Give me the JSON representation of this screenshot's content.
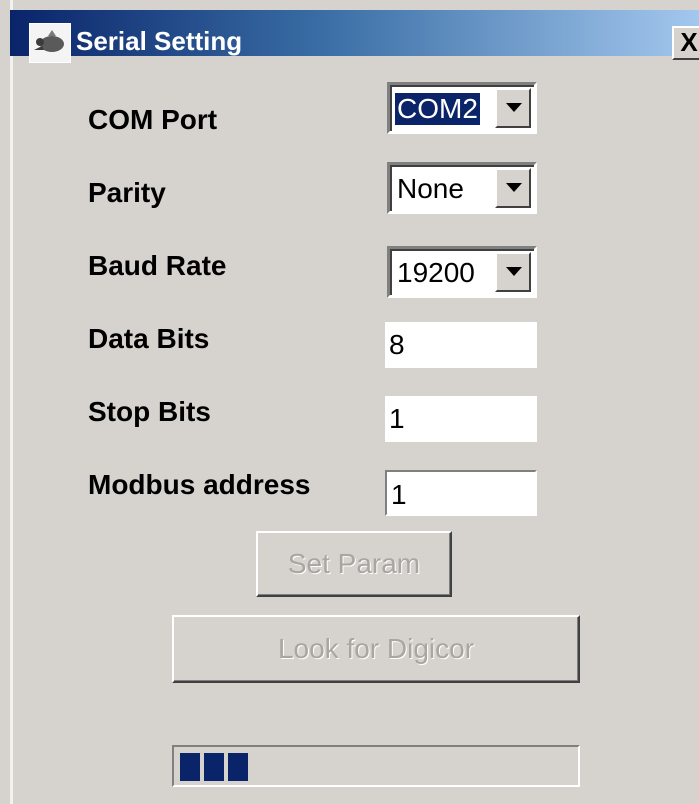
{
  "window": {
    "title": "Serial Setting",
    "close_glyph": "X",
    "icon": "app-icon"
  },
  "form": {
    "com_port": {
      "label": "COM Port",
      "value": "COM2"
    },
    "parity": {
      "label": "Parity",
      "value": "None"
    },
    "baud_rate": {
      "label": "Baud Rate",
      "value": "19200"
    },
    "data_bits": {
      "label": "Data Bits",
      "value": "8"
    },
    "stop_bits": {
      "label": "Stop Bits",
      "value": "1"
    },
    "modbus_address": {
      "label": "Modbus address",
      "value": "1"
    }
  },
  "buttons": {
    "set_param": "Set Param",
    "look_for": "Look for Digicor"
  },
  "progress": {
    "segments_filled": 3,
    "color": "#0a246a"
  }
}
